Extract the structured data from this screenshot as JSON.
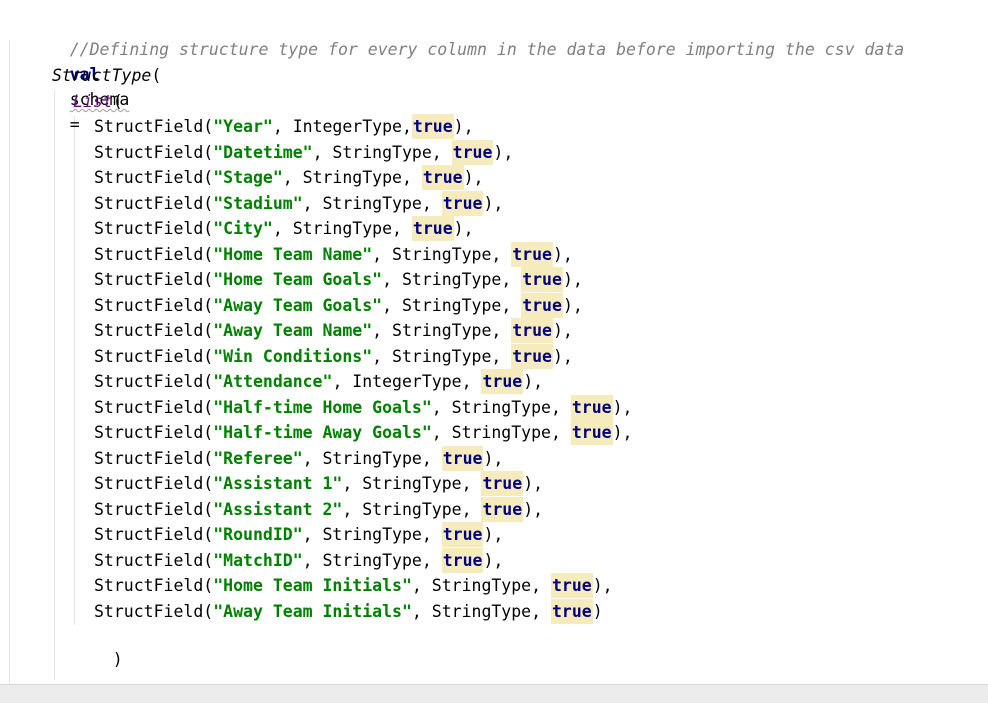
{
  "editor": {
    "comment": "//Defining structure type for every column in the data before importing the csv data",
    "val_keyword": "val",
    "var_name": "schema",
    "equals": "=",
    "struct_type": "StructType",
    "open_paren": "(",
    "list_keyword": "List",
    "list_close": ")",
    "struct_close": ")",
    "field_fn": "StructField(",
    "true_literal": "true",
    "fields": [
      {
        "name": "\"Year\"",
        "type": ", IntegerType,",
        "tail": "),"
      },
      {
        "name": "\"Datetime\"",
        "type": ", StringType, ",
        "tail": "),"
      },
      {
        "name": "\"Stage\"",
        "type": ", StringType, ",
        "tail": "),"
      },
      {
        "name": "\"Stadium\"",
        "type": ", StringType, ",
        "tail": "),"
      },
      {
        "name": "\"City\"",
        "type": ", StringType, ",
        "tail": "),"
      },
      {
        "name": "\"Home Team Name\"",
        "type": ", StringType, ",
        "tail": "),"
      },
      {
        "name": "\"Home Team Goals\"",
        "type": ", StringType, ",
        "tail": "),"
      },
      {
        "name": "\"Away Team Goals\"",
        "type": ", StringType, ",
        "tail": "),"
      },
      {
        "name": "\"Away Team Name\"",
        "type": ", StringType, ",
        "tail": "),"
      },
      {
        "name": "\"Win Conditions\"",
        "type": ", StringType, ",
        "tail": "),"
      },
      {
        "name": "\"Attendance\"",
        "type": ", IntegerType, ",
        "tail": "),"
      },
      {
        "name": "\"Half-time Home Goals\"",
        "type": ", StringType, ",
        "tail": "),"
      },
      {
        "name": "\"Half-time Away Goals\"",
        "type": ", StringType, ",
        "tail": "),"
      },
      {
        "name": "\"Referee\"",
        "type": ", StringType, ",
        "tail": "),"
      },
      {
        "name": "\"Assistant 1\"",
        "type": ", StringType, ",
        "tail": "),"
      },
      {
        "name": "\"Assistant 2\"",
        "type": ", StringType, ",
        "tail": "),"
      },
      {
        "name": "\"RoundID\"",
        "type": ", StringType, ",
        "tail": "),"
      },
      {
        "name": "\"MatchID\"",
        "type": ", StringType, ",
        "tail": "),"
      },
      {
        "name": "\"Home Team Initials\"",
        "type": ", StringType, ",
        "tail": "),"
      },
      {
        "name": "\"Away Team Initials\"",
        "type": ", StringType, ",
        "tail": ")"
      }
    ]
  },
  "colors": {
    "comment": "#808080",
    "keyword": "#000080",
    "string": "#008000",
    "highlight": "#f6ebbc",
    "purple": "#660e7a"
  }
}
